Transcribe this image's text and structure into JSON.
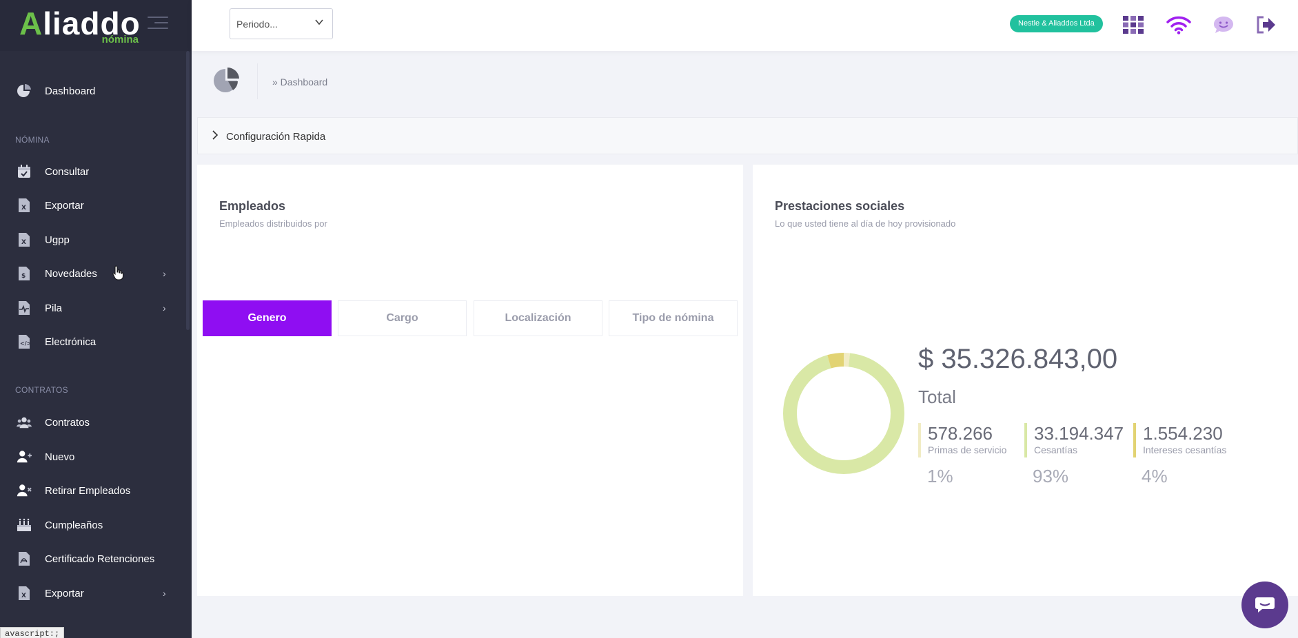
{
  "logo": {
    "main_a": "A",
    "main_rest": "liaddo",
    "sub": "nómina"
  },
  "sidebar": {
    "items": [
      {
        "label": "Dashboard",
        "icon": "pie-chart-icon"
      },
      {
        "label": "Consultar",
        "icon": "calendar-check-icon"
      },
      {
        "label": "Exportar",
        "icon": "excel-file-icon"
      },
      {
        "label": "Ugpp",
        "icon": "excel-file-icon"
      },
      {
        "label": "Novedades",
        "icon": "dollar-file-icon",
        "arrow": "›"
      },
      {
        "label": "Pila",
        "icon": "pulse-file-icon",
        "arrow": "›"
      },
      {
        "label": "Electrónica",
        "icon": "code-file-icon"
      },
      {
        "label": "Contratos",
        "icon": "users-icon"
      },
      {
        "label": "Nuevo",
        "icon": "user-plus-icon"
      },
      {
        "label": "Retirar Empleados",
        "icon": "user-remove-icon"
      },
      {
        "label": "Cumpleaños",
        "icon": "birthday-cake-icon"
      },
      {
        "label": "Certificado Retenciones",
        "icon": "pdf-file-icon"
      },
      {
        "label": "Exportar",
        "icon": "excel-file-icon",
        "arrow": "›"
      }
    ],
    "sections": {
      "nomina": "NÓMINA",
      "contratos": "CONTRATOS"
    }
  },
  "status_tooltip": "avascript:;",
  "topbar": {
    "periodo_value": "Periodo...",
    "company": "Nestle & Aliaddos Ltda"
  },
  "breadcrumb": "» Dashboard",
  "config": {
    "label": "Configuración Rapida"
  },
  "empleados": {
    "title": "Empleados",
    "subtitle": "Empleados distribuidos por",
    "tabs": [
      "Genero",
      "Cargo",
      "Localización",
      "Tipo de nómina"
    ]
  },
  "prestaciones": {
    "title": "Prestaciones sociales",
    "subtitle": "Lo que usted tiene al día de hoy provisionado",
    "total_amount": "$ 35.326.843,00",
    "total_label": "Total",
    "stats": [
      {
        "value": "578.266",
        "name": "Primas de servicio",
        "pct": "1%",
        "fraction": 0.0164,
        "color": "#f1ecc4"
      },
      {
        "value": "33.194.347",
        "name": "Cesantías",
        "pct": "93%",
        "fraction": 0.9396,
        "color": "#d9e8a6"
      },
      {
        "value": "1.554.230",
        "name": "Intereses cesantías",
        "pct": "4%",
        "fraction": 0.044,
        "color": "#e2d373"
      }
    ]
  },
  "colors": {
    "accent": "#8f0ef2",
    "sidebar": "#2c2e3e",
    "badge": "#21c19e",
    "chat": "#5b3a8e"
  }
}
